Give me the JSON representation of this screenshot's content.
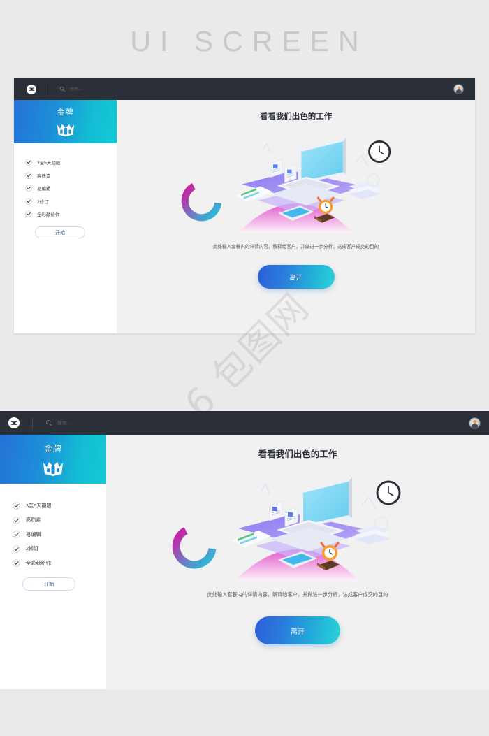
{
  "page": {
    "title": "UI SCREEN",
    "watermark": "6 包图网",
    "background_color": "#eaeaea"
  },
  "navbar": {
    "logo_icon": "brand-logo-icon",
    "search": {
      "icon": "search-icon",
      "placeholder": "搜索...",
      "value": ""
    },
    "avatar_icon": "user-avatar"
  },
  "sidebar": {
    "plan": {
      "title": "金牌",
      "badge_icon": "crown-badge-icon",
      "gradient_from": "#2472d6",
      "gradient_to": "#12cbd6"
    },
    "features": [
      {
        "icon": "check-circle-icon",
        "label": "3至5天期限"
      },
      {
        "icon": "check-circle-icon",
        "label": "高质素"
      },
      {
        "icon": "check-circle-icon",
        "label": "易编辑"
      },
      {
        "icon": "check-circle-icon",
        "label": "2修订"
      },
      {
        "icon": "check-circle-icon",
        "label": "全彩献给你"
      }
    ],
    "start_button": "开始"
  },
  "main": {
    "heading": "看看我们出色的工作",
    "illustration": {
      "name": "isometric-workspace-illustration",
      "elements": [
        "desktop-monitor",
        "keyboard",
        "wall-clock",
        "alarm-clock",
        "tablet",
        "notebook",
        "documents",
        "paper-stack",
        "calculator",
        "arc-chart"
      ]
    },
    "description": "此处输入套餐内的详情内容，解释给客户，并做进一步分析，达成客户成交的目的",
    "cta_button": "离开",
    "cta_gradient_from": "#2b5fd9",
    "cta_gradient_to": "#2ad2d8"
  }
}
